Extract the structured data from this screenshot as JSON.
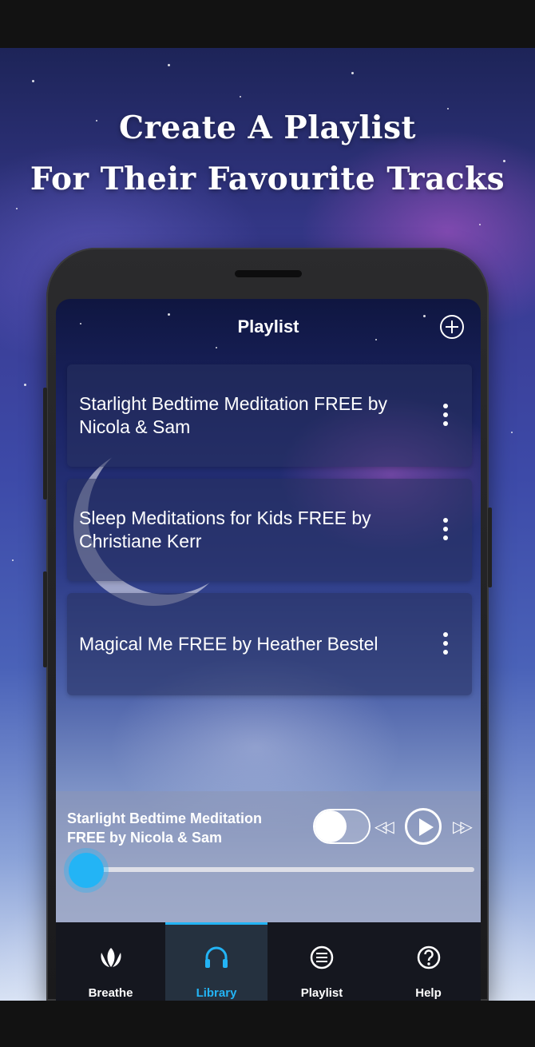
{
  "promo": {
    "headline_line1": "Create A Playlist",
    "headline_line2": "For Their Favourite Tracks"
  },
  "screen": {
    "title": "Playlist",
    "add_icon": "plus-circle-icon"
  },
  "tracks": [
    {
      "title": "Starlight Bedtime Meditation FREE by Nicola & Sam"
    },
    {
      "title": "Sleep Meditations for Kids FREE by Christiane Kerr"
    },
    {
      "title": "Magical Me FREE by Heather Bestel"
    }
  ],
  "player": {
    "now_playing": "Starlight Bedtime Meditation FREE by Nicola & Sam",
    "loop_toggle_on": false,
    "progress": 0.0,
    "accent_color": "#23b4f5"
  },
  "tabs": [
    {
      "label": "Breathe",
      "icon": "lotus-icon",
      "active": false
    },
    {
      "label": "Library",
      "icon": "headphones-icon",
      "active": true
    },
    {
      "label": "Playlist",
      "icon": "list-icon",
      "active": false
    },
    {
      "label": "Help",
      "icon": "question-icon",
      "active": false
    }
  ]
}
